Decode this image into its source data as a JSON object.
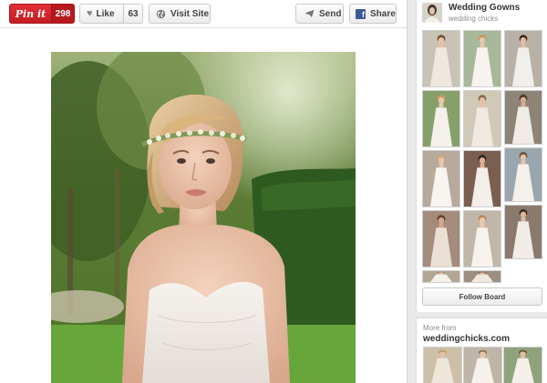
{
  "toolbar": {
    "pin_label": "Pin it",
    "pin_count": "298",
    "like_label": "Like",
    "like_count": "63",
    "visit_label": "Visit Site",
    "send_label": "Send",
    "share_label": "Share"
  },
  "icons": {
    "like": "heart-icon",
    "visit": "globe-icon",
    "send": "paper-plane-icon",
    "share": "facebook-icon"
  },
  "colors": {
    "pin_red": "#cb2027",
    "facebook_blue": "#3b5998"
  },
  "pin_image": {
    "subject": "bride in strapless white gown with floral crown"
  },
  "board": {
    "title": "Wedding Gowns",
    "owner": "wedding chicks",
    "follow_label": "Follow Board",
    "thumbnails": [
      "thumb-1",
      "thumb-2",
      "thumb-3",
      "thumb-4",
      "thumb-5",
      "thumb-6",
      "thumb-7",
      "thumb-8",
      "thumb-9",
      "thumb-10",
      "thumb-11",
      "thumb-12",
      "thumb-13",
      "thumb-14"
    ]
  },
  "more_from": {
    "label": "More from",
    "source": "weddingchicks.com"
  }
}
